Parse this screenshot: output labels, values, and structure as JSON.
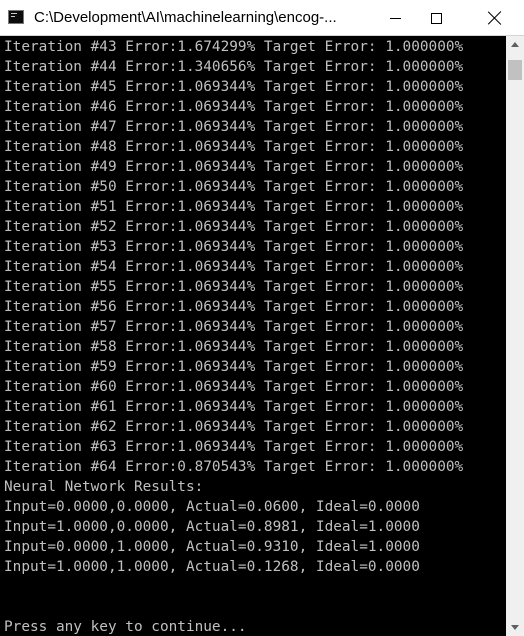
{
  "window": {
    "title": "C:\\Development\\AI\\machinelearning\\encog-...",
    "icon": "console-app-icon",
    "controls": [
      "minimize-icon",
      "maximize-icon",
      "close-icon"
    ]
  },
  "console": {
    "lines": [
      "Iteration #43 Error:1.674299% Target Error: 1.000000%",
      "Iteration #44 Error:1.340656% Target Error: 1.000000%",
      "Iteration #45 Error:1.069344% Target Error: 1.000000%",
      "Iteration #46 Error:1.069344% Target Error: 1.000000%",
      "Iteration #47 Error:1.069344% Target Error: 1.000000%",
      "Iteration #48 Error:1.069344% Target Error: 1.000000%",
      "Iteration #49 Error:1.069344% Target Error: 1.000000%",
      "Iteration #50 Error:1.069344% Target Error: 1.000000%",
      "Iteration #51 Error:1.069344% Target Error: 1.000000%",
      "Iteration #52 Error:1.069344% Target Error: 1.000000%",
      "Iteration #53 Error:1.069344% Target Error: 1.000000%",
      "Iteration #54 Error:1.069344% Target Error: 1.000000%",
      "Iteration #55 Error:1.069344% Target Error: 1.000000%",
      "Iteration #56 Error:1.069344% Target Error: 1.000000%",
      "Iteration #57 Error:1.069344% Target Error: 1.000000%",
      "Iteration #58 Error:1.069344% Target Error: 1.000000%",
      "Iteration #59 Error:1.069344% Target Error: 1.000000%",
      "Iteration #60 Error:1.069344% Target Error: 1.000000%",
      "Iteration #61 Error:1.069344% Target Error: 1.000000%",
      "Iteration #62 Error:1.069344% Target Error: 1.000000%",
      "Iteration #63 Error:1.069344% Target Error: 1.000000%",
      "Iteration #64 Error:0.870543% Target Error: 1.000000%",
      "Neural Network Results:",
      "Input=0.0000,0.0000, Actual=0.0600, Ideal=0.0000",
      "Input=1.0000,0.0000, Actual=0.8981, Ideal=1.0000",
      "Input=0.0000,1.0000, Actual=0.9310, Ideal=1.0000",
      "Input=1.0000,1.0000, Actual=0.1268, Ideal=0.0000",
      "",
      "",
      "Press any key to continue..."
    ],
    "text_color": "#c0c0c0",
    "background": "#000000"
  }
}
